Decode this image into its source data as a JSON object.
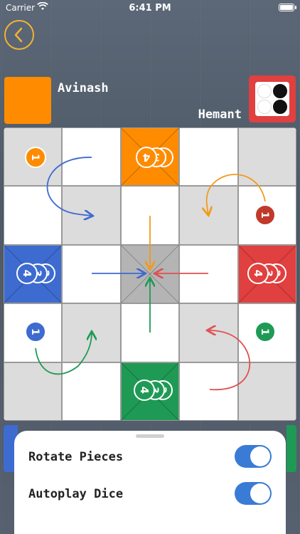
{
  "status_bar": {
    "carrier": "Carrier",
    "time": "6:41 PM"
  },
  "header": {
    "back_icon": "chevron-left-icon"
  },
  "players": {
    "player1": {
      "name": "Avinash",
      "color": "#ff8c00"
    },
    "player2": {
      "name": "Hemant",
      "dice_color": "#e0403f"
    }
  },
  "dice": {
    "pips": [
      0,
      1,
      0,
      1
    ]
  },
  "board": {
    "colors": {
      "orange": "#ff8c00",
      "red": "#e0403f",
      "blue": "#3d6bd0",
      "green": "#1f9a55",
      "grey": "#dcdcdc"
    },
    "homes": {
      "top": {
        "color": "orange",
        "stack": [
          "4",
          "3",
          "2"
        ]
      },
      "left": {
        "color": "blue",
        "stack": [
          "4",
          "3",
          "2"
        ]
      },
      "right": {
        "color": "red",
        "stack": [
          "4",
          "3",
          "2"
        ]
      },
      "bottom": {
        "color": "green",
        "stack": [
          "4",
          "3",
          "2"
        ]
      }
    },
    "pieces": [
      {
        "color": "orange",
        "label": "1"
      },
      {
        "color": "red",
        "label": "1"
      },
      {
        "color": "blue",
        "label": "1"
      },
      {
        "color": "green",
        "label": "1"
      }
    ]
  },
  "settings": {
    "rotate_pieces": {
      "label": "Rotate Pieces",
      "enabled": true
    },
    "autoplay_dice": {
      "label": "Autoplay Dice",
      "enabled": true
    }
  }
}
